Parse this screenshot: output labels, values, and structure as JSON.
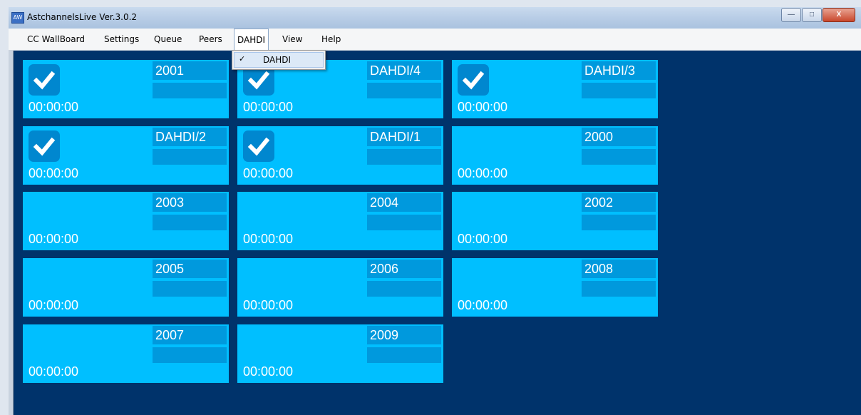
{
  "window": {
    "title": "AstchannelsLive Ver.3.0.2",
    "icon": "app-icon"
  },
  "window_buttons": {
    "minimize": "—",
    "maximize": "□",
    "close": "X"
  },
  "menu": [
    {
      "label": "CC WallBoard"
    },
    {
      "label": "Settings"
    },
    {
      "label": "Queue"
    },
    {
      "label": "Peers"
    },
    {
      "label": "DAHDI",
      "open": true
    },
    {
      "label": "View"
    },
    {
      "label": "Help"
    }
  ],
  "dropdown": {
    "items": [
      {
        "label": "DAHDI",
        "checked": true,
        "check_glyph": "✓"
      }
    ]
  },
  "tiles": [
    {
      "name": "2001",
      "time": "00:00:00",
      "checked": true
    },
    {
      "name": "DAHDI/4",
      "time": "00:00:00",
      "checked": true
    },
    {
      "name": "DAHDI/3",
      "time": "00:00:00",
      "checked": true
    },
    {
      "name": "DAHDI/2",
      "time": "00:00:00",
      "checked": true
    },
    {
      "name": "DAHDI/1",
      "time": "00:00:00",
      "checked": true
    },
    {
      "name": "2000",
      "time": "00:00:00",
      "checked": false
    },
    {
      "name": "2003",
      "time": "00:00:00",
      "checked": false
    },
    {
      "name": "2004",
      "time": "00:00:00",
      "checked": false
    },
    {
      "name": "2002",
      "time": "00:00:00",
      "checked": false
    },
    {
      "name": "2005",
      "time": "00:00:00",
      "checked": false
    },
    {
      "name": "2006",
      "time": "00:00:00",
      "checked": false
    },
    {
      "name": "2008",
      "time": "00:00:00",
      "checked": false
    },
    {
      "name": "2007",
      "time": "00:00:00",
      "checked": false
    },
    {
      "name": "2009",
      "time": "00:00:00",
      "checked": false
    }
  ],
  "colors": {
    "board_bg": "#00336b",
    "tile_bg": "#00bfff",
    "tile_label_bg": "#0099dd",
    "check_bg": "#0087cf"
  }
}
